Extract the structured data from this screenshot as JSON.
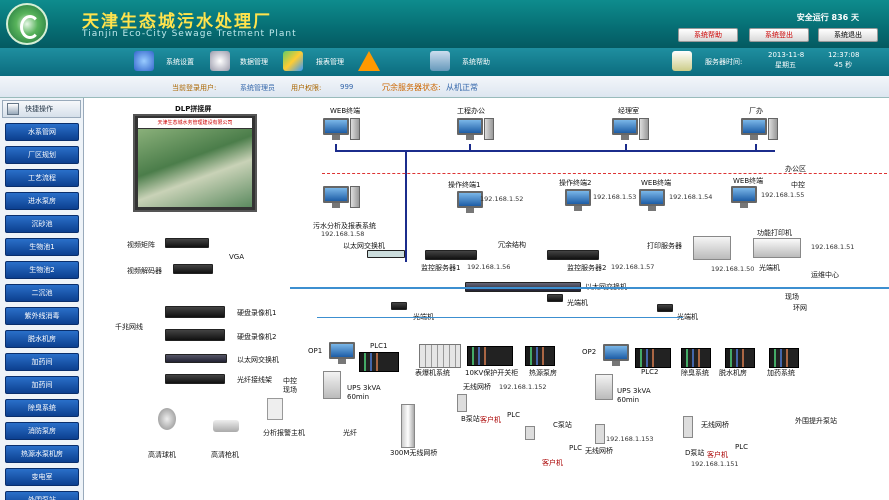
{
  "header": {
    "title_cn": "天津生态城污水处理厂",
    "title_en": "Tianjin Eco-City Sewage Tretment Plant",
    "safe_run": "安全运行 836 天",
    "btn_switch": "系统帮助",
    "btn_logout": "系统登出",
    "btn_exit": "系统退出"
  },
  "toolbar": {
    "settings": "系统设置",
    "data": "数据管理",
    "report": "报表管理",
    "help": "系统帮助",
    "server_time": "服务器时间:",
    "date": "2013-11-8",
    "weekday": "星期五",
    "time": "12:37:08",
    "time2": "45 秒"
  },
  "status": {
    "user_label": "当前登录用户:",
    "user": "系统管理员",
    "perm_label": "用户权限:",
    "perm": "999",
    "redundancy": "冗余服务器状态:",
    "redundancy_value": "从机正常"
  },
  "sidebar": {
    "head": "快捷操作",
    "items": [
      "水系管网",
      "厂区规划",
      "工艺流程",
      "进水泵房",
      "沉砂池",
      "生物池1",
      "生物池2",
      "二沉池",
      "紫外线消毒",
      "脱水机房",
      "加药间",
      "加药间",
      "除臭系统",
      "消防泵房",
      "热源水泵机房",
      "变电室",
      "外围泵站"
    ]
  },
  "labels": {
    "dlp": "DLP拼接屏",
    "video_matrix": "视频矩阵",
    "video_decoder": "视频解码器",
    "vga": "VGA",
    "gigabit": "千兆网线",
    "dvr1": "硬盘录像机1",
    "dvr2": "硬盘录像机2",
    "eth_sw1": "以太网交换机",
    "fiber_box": "光纤接线架",
    "ctrl_room": "中控\n现场",
    "ball_cam": "高清球机",
    "gun_cam": "高清枪机",
    "dist_host": "分析报警主机",
    "optic_fiber": "光纤",
    "web1": "WEB终端",
    "office": "工程办公",
    "manager": "经理室",
    "factory": "厂办",
    "office_area": "办公区",
    "central": "中控",
    "sep_sys": "污水分析及报表系统",
    "sep_ip": "192.168.1.58",
    "eth_sw2": "以太网交换机",
    "op1": "操作终端1",
    "op1_ip": "192.168.1.52",
    "op2": "操作终端2",
    "op2_ip": "192.168.1.53",
    "web2": "WEB终端",
    "web2_ip": "192.168.1.54",
    "web3": "WEB终端",
    "web3_ip": "192.168.1.55",
    "redundant": "冗余结构",
    "srv1": "监控服务器1",
    "srv1_ip": "192.168.1.56",
    "srv2": "监控服务器2",
    "srv2_ip": "192.168.1.57",
    "print_srv": "打印服务器",
    "print_srv_ip": "192.168.1.50",
    "func_printer": "功能打印机",
    "func_printer_ip": "192.168.1.51",
    "fiber_sw": "光端机",
    "ops_center": "运维中心",
    "eth_sw3": "以太网交换机",
    "field": "现场",
    "ring": "环网",
    "fiber1": "光端机",
    "fiber2": "光端机",
    "fiber3": "光端机",
    "op1b": "OP1",
    "plc1": "PLC1",
    "ups1": "UPS 3kVA\n60min",
    "meter": "表爆机系统",
    "hv": "10KV保护开关柜",
    "thermal": "热源泵房",
    "op2b": "OP2",
    "plc2": "PLC2",
    "ups2": "UPS 3kVA\n60min",
    "deodor": "除臭系统",
    "dewater": "脱水机房",
    "dosing": "加药系统",
    "wifi": "300M无线网桥",
    "wlan1": "无线网桥",
    "wlan1_ip": "192.168.1.152",
    "b_station": "B泵站",
    "client1": "客户机",
    "plc_b": "PLC",
    "c_station": "C泵站",
    "client2": "客户机",
    "plc_c": "PLC",
    "wlan2": "无线网桥",
    "wlan2_ip": "192.168.1.153",
    "outer": "外围提升泵站",
    "wlan3": "无线网桥",
    "d_station": "D泵站",
    "client3": "客户机",
    "plc_d": "PLC",
    "wlan3_ip": "192.168.1.151",
    "dlp_title": "天津生态城水务管理建设有限公司"
  }
}
